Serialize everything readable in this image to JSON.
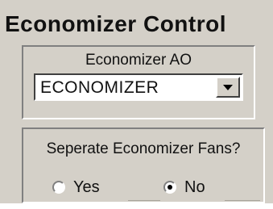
{
  "window": {
    "title": "Economizer Control"
  },
  "ao_group": {
    "label": "Economizer AO",
    "dropdown": {
      "selected": "ECONOMIZER"
    }
  },
  "fans_group": {
    "label": "Seperate Economizer Fans?",
    "options": [
      {
        "label": "Yes",
        "checked": false
      },
      {
        "label": "No",
        "checked": true
      }
    ]
  },
  "icons": {
    "dropdown_arrow": "chevron-down-icon"
  }
}
